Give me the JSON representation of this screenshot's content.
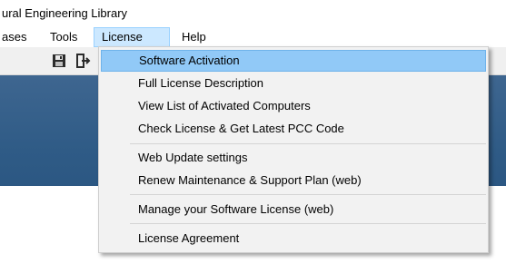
{
  "window": {
    "title": "ural Engineering Library"
  },
  "menubar": {
    "items": [
      {
        "label": "ases"
      },
      {
        "label": "Tools"
      },
      {
        "label": "License"
      },
      {
        "label": "Help"
      }
    ]
  },
  "toolbar": {
    "icons": [
      "save-icon",
      "exit-icon"
    ]
  },
  "license_menu": {
    "items": [
      {
        "label": "Software Activation"
      },
      {
        "label": "Full License Description"
      },
      {
        "label": "View List of Activated Computers"
      },
      {
        "label": "Check License & Get Latest PCC Code"
      },
      {
        "label": "Web Update settings"
      },
      {
        "label": "Renew Maintenance & Support Plan  (web)"
      },
      {
        "label": "Manage your Software License  (web)"
      },
      {
        "label": "License Agreement"
      }
    ]
  },
  "colors": {
    "menu_highlight": "#91c9f7",
    "active_menu": "#cce8ff",
    "background_blue": "#2f5b86"
  }
}
